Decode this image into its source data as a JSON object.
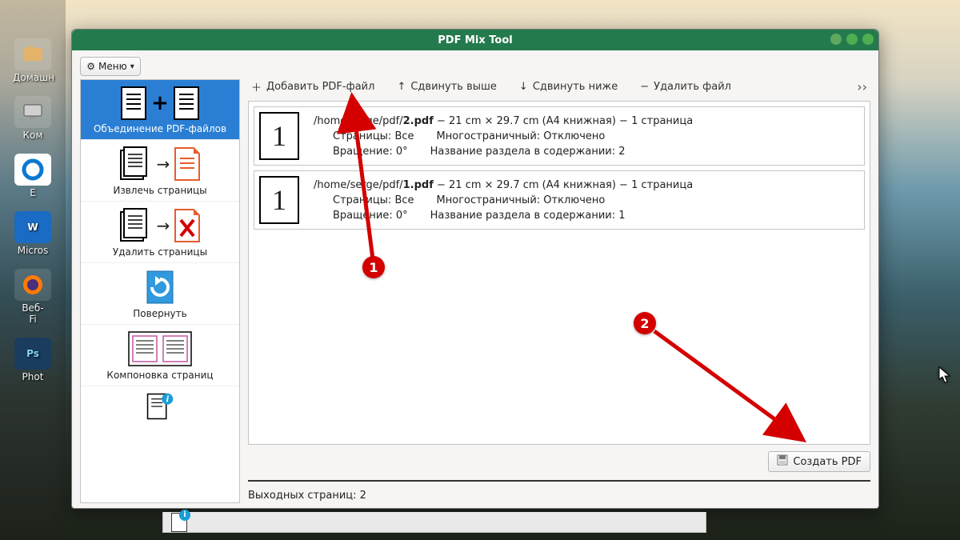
{
  "window": {
    "title": "PDF Mix Tool"
  },
  "menu": {
    "label": "Меню"
  },
  "taskbar": {
    "home": "Домашн",
    "comp": "Ком",
    "edge": "E",
    "ms": "Micros",
    "web": "Веб-",
    "fi": "Fi",
    "photo": "Phot"
  },
  "sidebar": {
    "items": [
      {
        "label": "Объединение PDF-файлов"
      },
      {
        "label": "Извлечь страницы"
      },
      {
        "label": "Удалить страницы"
      },
      {
        "label": "Повернуть"
      },
      {
        "label": "Компоновка страниц"
      },
      {
        "label": ""
      }
    ]
  },
  "toolbar": {
    "add": "Добавить PDF-файл",
    "up": "Сдвинуть выше",
    "down": "Сдвинуть ниже",
    "remove": "Удалить файл",
    "more": "››"
  },
  "files": [
    {
      "thumb": "1",
      "path_prefix": "/home/serge/pdf/",
      "path_bold": "2.pdf",
      "path_suffix": " − 21 cm × 29.7 cm (A4 книжная) − 1 страница",
      "pages_label": "Страницы:",
      "pages_value": "Все",
      "multi_label": "Многостраничный:",
      "multi_value": "Отключено",
      "rot_label": "Вращение:",
      "rot_value": "0°",
      "section_label": "Название раздела в содержании:",
      "section_value": "2"
    },
    {
      "thumb": "1",
      "path_prefix": "/home/serge/pdf/",
      "path_bold": "1.pdf",
      "path_suffix": " − 21 cm × 29.7 cm (A4 книжная) − 1 страница",
      "pages_label": "Страницы:",
      "pages_value": "Все",
      "multi_label": "Многостраничный:",
      "multi_value": "Отключено",
      "rot_label": "Вращение:",
      "rot_value": "0°",
      "section_label": "Название раздела в содержании:",
      "section_value": "1"
    }
  ],
  "generate": {
    "label": "Создать PDF"
  },
  "status": {
    "text": "Выходных страниц: 2"
  },
  "annotations": {
    "mark1": "1",
    "mark2": "2"
  }
}
